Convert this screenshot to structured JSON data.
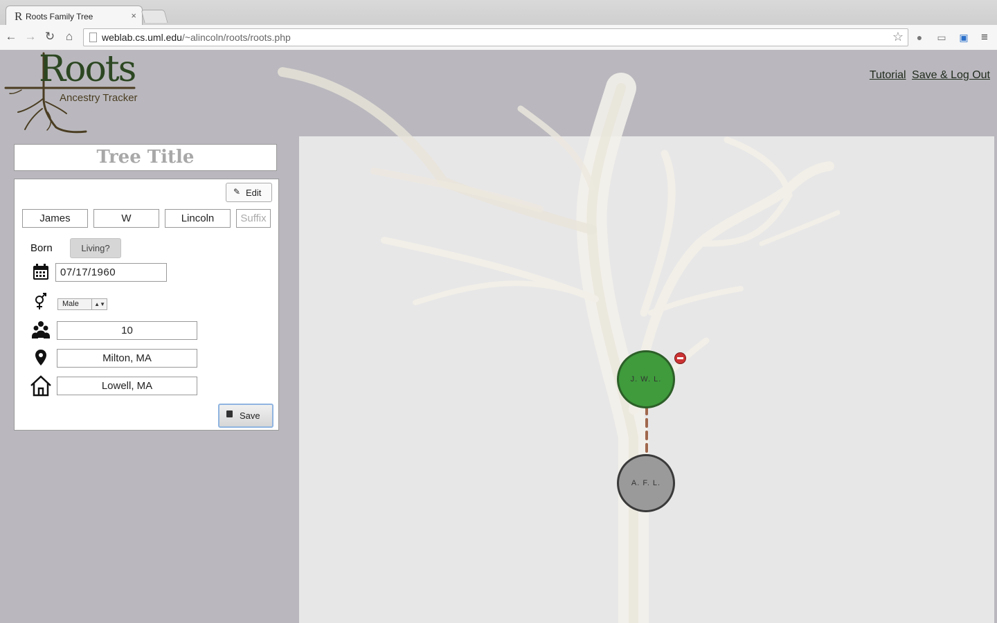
{
  "browser": {
    "tab_title": "Roots Family Tree",
    "tab_favicon": "R",
    "tab_close": "×",
    "url_host": "weblab.cs.uml.edu",
    "url_path": "/~alincoln/roots/roots.php",
    "icons": [
      "back-icon",
      "forward-icon",
      "reload-icon",
      "home-icon",
      "star-icon",
      "menu-icon"
    ]
  },
  "app": {
    "logo_title": "Roots",
    "logo_subtitle": "Ancestry Tracker",
    "nav": {
      "tutorial": "Tutorial",
      "save_logout": "Save & Log Out"
    },
    "tree_title": "Tree Title"
  },
  "editor": {
    "edit_label": "Edit",
    "first_name": "James",
    "middle_name": "W",
    "last_name": "Lincoln",
    "suffix_placeholder": "Suffix",
    "born_label": "Born",
    "living_label": "Living?",
    "birth_date": "07/17/1960",
    "gender": "Male",
    "generation": "10",
    "birth_place": "Milton, MA",
    "residence": "Lowell, MA",
    "save_label": "Save"
  },
  "tree": {
    "nodes": [
      {
        "initials": "J. W. L.",
        "color": "#3f9b3c",
        "selected": true
      },
      {
        "initials": "A. F. L.",
        "color": "#9b9a9b",
        "selected": false
      }
    ],
    "link_color": "#a0684d"
  }
}
